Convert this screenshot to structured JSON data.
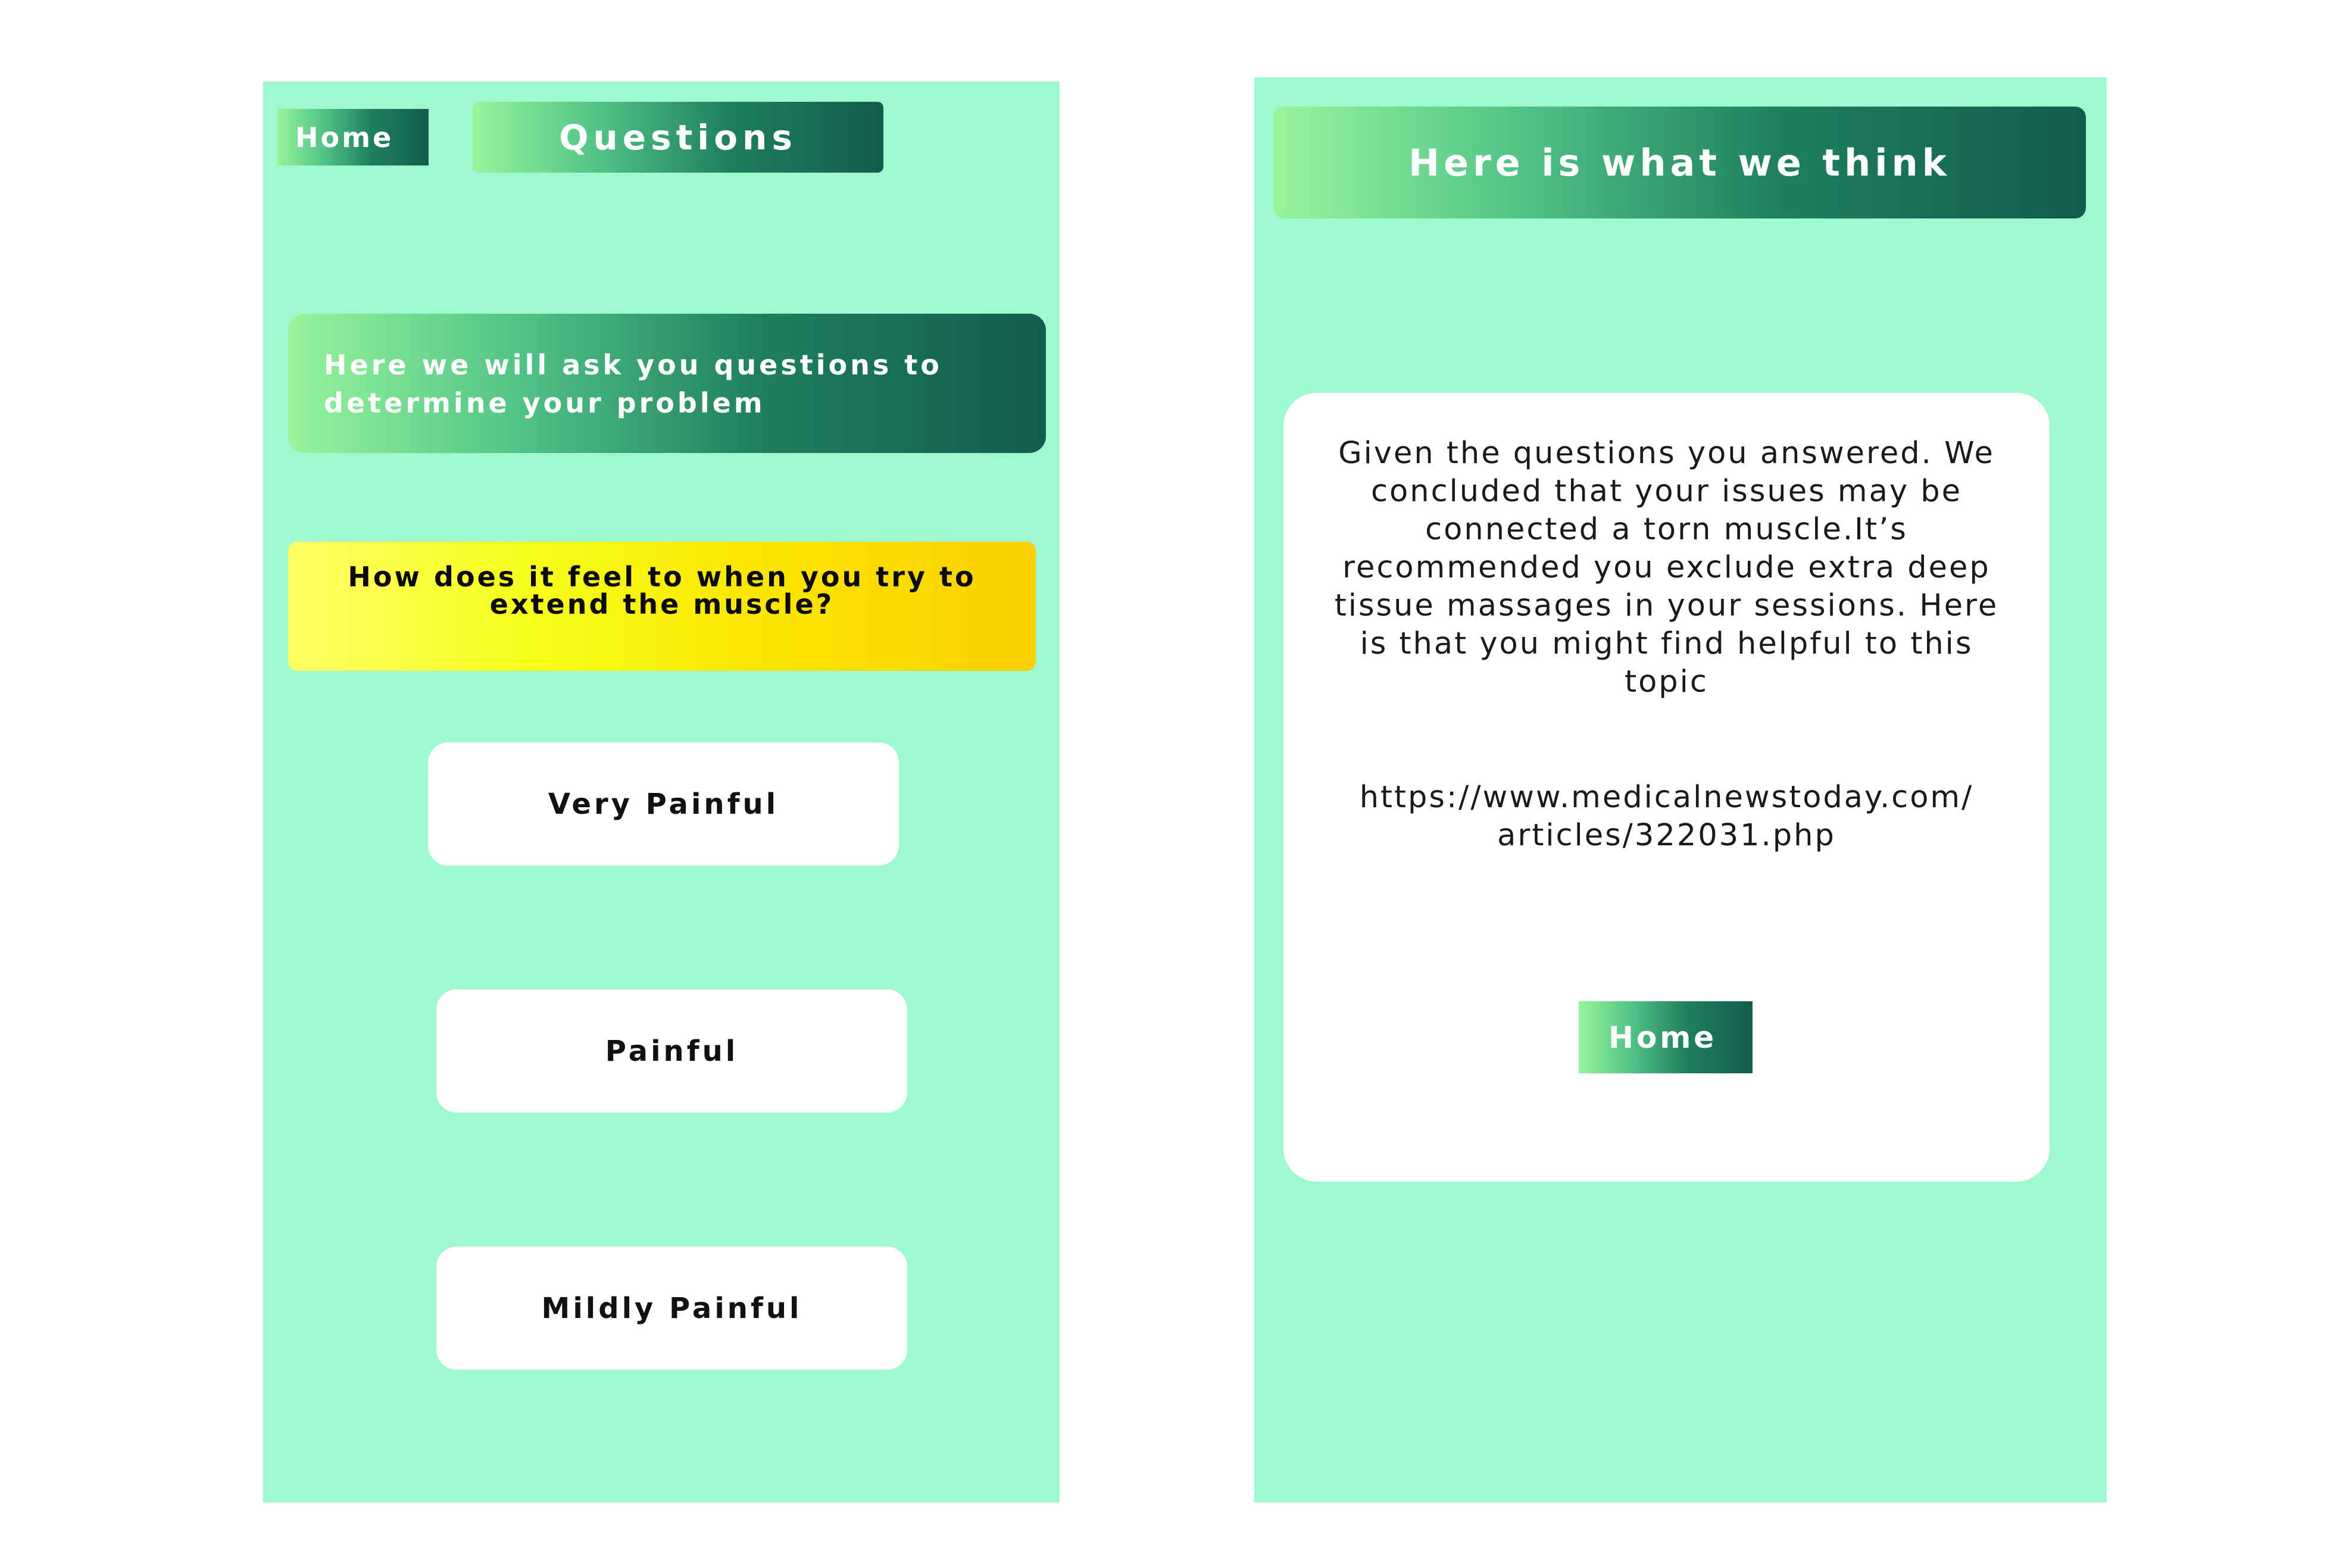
{
  "colors": {
    "screen_background": "#a0f8ce",
    "gradient_light": "#97f59c",
    "gradient_dark": "#115d4e",
    "question_gradient_light": "#ffff66",
    "question_gradient_dark": "#fbcf00",
    "card_background": "#ffffff"
  },
  "questions_screen": {
    "home_label": "Home",
    "title": "Questions",
    "intro_line_1": "Here we will ask you questions to",
    "intro_line_2": "determine your problem",
    "question_line_1": "How does it feel to when you try to",
    "question_line_2": "extend the muscle?",
    "answers": [
      "Very Painful",
      "Painful",
      "Mildly Painful"
    ]
  },
  "result_screen": {
    "header": "Here is what we think",
    "body_lines": [
      "Given the questions you answered. We",
      "concluded that your issues may be",
      "connected a torn muscle.It’s",
      "recommended you exclude extra deep",
      "tissue massages in your sessions. Here",
      "is that you might find helpful to this",
      "topic"
    ],
    "link_lines": [
      "https://www.medicalnewstoday.com/",
      "articles/322031.php"
    ],
    "home_label": "Home"
  }
}
